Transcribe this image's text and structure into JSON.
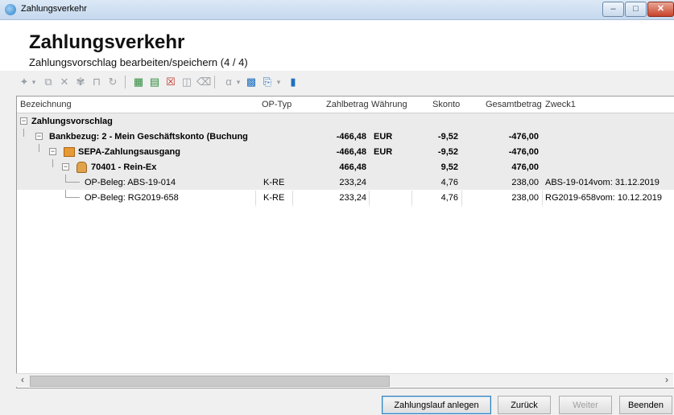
{
  "window": {
    "title": "Zahlungsverkehr"
  },
  "header": {
    "title": "Zahlungsverkehr",
    "subtitle": "Zahlungsvorschlag bearbeiten/speichern (4 / 4)"
  },
  "grid": {
    "columns": [
      "Bezeichnung",
      "OP-Typ",
      "Zahlbetrag",
      "Währung",
      "Skonto",
      "Gesamtbetrag",
      "Zweck1"
    ],
    "rows": [
      {
        "label": "Zahlungsvorschlag",
        "op_typ": "",
        "zahlbetrag": "",
        "waehrung": "",
        "skonto": "",
        "gesamt": "",
        "zweck": ""
      },
      {
        "label": "Bankbezug: 2 - Mein Geschäftskonto (Buchung",
        "op_typ": "",
        "zahlbetrag": "-466,48",
        "waehrung": "EUR",
        "skonto": "-9,52",
        "gesamt": "-476,00",
        "zweck": ""
      },
      {
        "label": "SEPA-Zahlungsausgang",
        "op_typ": "",
        "zahlbetrag": "-466,48",
        "waehrung": "EUR",
        "skonto": "-9,52",
        "gesamt": "-476,00",
        "zweck": ""
      },
      {
        "label": "70401 - Rein-Ex",
        "op_typ": "",
        "zahlbetrag": "466,48",
        "waehrung": "",
        "skonto": "9,52",
        "gesamt": "476,00",
        "zweck": ""
      },
      {
        "label": "OP-Beleg: ABS-19-014",
        "op_typ": "K-RE",
        "zahlbetrag": "233,24",
        "waehrung": "",
        "skonto": "4,76",
        "gesamt": "238,00",
        "zweck": "ABS-19-014vom: 31.12.2019"
      },
      {
        "label": "OP-Beleg: RG2019-658",
        "op_typ": "K-RE",
        "zahlbetrag": "233,24",
        "waehrung": "",
        "skonto": "4,76",
        "gesamt": "238,00",
        "zweck": "RG2019-658vom: 10.12.2019"
      }
    ]
  },
  "buttons": {
    "zahlungslauf": "Zahlungslauf anlegen",
    "zurueck": "Zurück",
    "weiter": "Weiter",
    "beenden": "Beenden"
  },
  "icons": {
    "toolbar": [
      "wand-icon",
      "dropdown-arrow",
      "copy-icon",
      "delete-icon",
      "filter-icon",
      "split-icon",
      "refresh-icon",
      "new-green-icon",
      "edit-icon",
      "remove-red-icon",
      "transfer-icon",
      "eraser-icon",
      "funnel-icon",
      "dropdown-arrow",
      "document-icon",
      "printer-icon",
      "dropdown-arrow",
      "exit-icon"
    ]
  }
}
